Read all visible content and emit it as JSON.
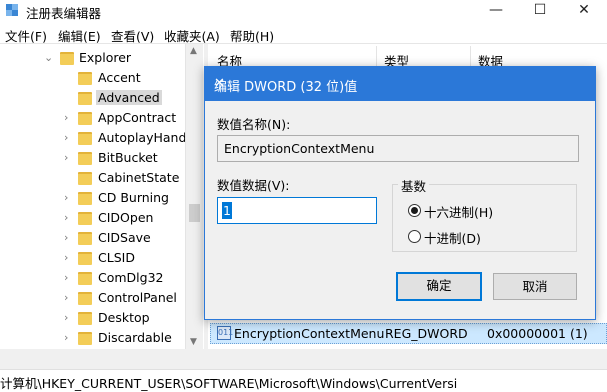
{
  "window": {
    "title": "注册表编辑器",
    "min_glyph": "—",
    "max_glyph": "☐",
    "close_glyph": "✕"
  },
  "menu": [
    "文件(F)",
    "编辑(E)",
    "查看(V)",
    "收藏夹(A)",
    "帮助(H)"
  ],
  "tree": {
    "parent": "Explorer",
    "items": [
      "Accent",
      "Advanced",
      "AppContract",
      "AutoplayHandle",
      "BitBucket",
      "CabinetState",
      "CD Burning",
      "CIDOpen",
      "CIDSave",
      "CLSID",
      "ComDlg32",
      "ControlPanel",
      "Desktop",
      "Discardable"
    ],
    "selected": "Advanced"
  },
  "list": {
    "columns": [
      "名称",
      "类型",
      "数据"
    ],
    "row": {
      "name": "EncryptionContextMenu",
      "type": "REG_DWORD",
      "data": "0x00000001 (1)"
    }
  },
  "status": {
    "path": "计算机\\HKEY_CURRENT_USER\\SOFTWARE\\Microsoft\\Windows\\CurrentVersi"
  },
  "dialog": {
    "title": "编辑 DWORD (32 位)值",
    "close_glyph": "✕",
    "name_label": "数值名称(N):",
    "name_value": "EncryptionContextMenu",
    "data_label": "数值数据(V):",
    "data_value": "1",
    "base_label": "基数",
    "hex_label": "十六进制(H)",
    "dec_label": "十进制(D)",
    "base_selected": "hex",
    "ok_label": "确定",
    "cancel_label": "取消"
  }
}
